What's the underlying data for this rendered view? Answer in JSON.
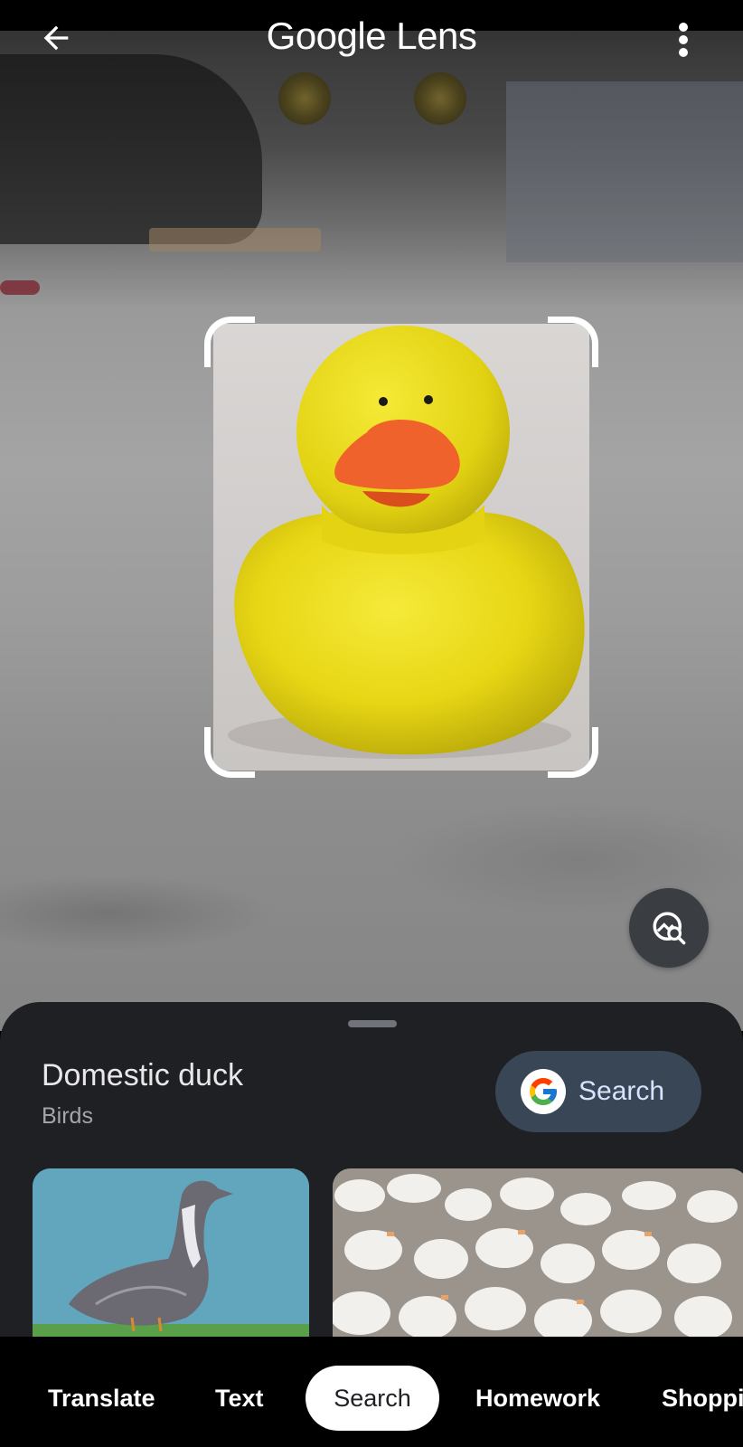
{
  "app": {
    "title": "Google Lens"
  },
  "icons": {
    "back": "arrow-left-icon",
    "more": "more-vert-icon",
    "lens_fab": "image-search-icon",
    "google": "google-g-icon"
  },
  "result": {
    "title": "Domestic duck",
    "subtitle": "Birds",
    "search_button_label": "Search"
  },
  "tabs": [
    {
      "label": "Translate",
      "active": false
    },
    {
      "label": "Text",
      "active": false
    },
    {
      "label": "Search",
      "active": true
    },
    {
      "label": "Homework",
      "active": false
    },
    {
      "label": "Shoppi",
      "active": false
    }
  ],
  "colors": {
    "sheet_bg": "#1f2024",
    "search_pill": "#394656",
    "search_pill_text": "#d7e3ff",
    "duck_yellow": "#f1e117",
    "beak_orange": "#f0622b"
  }
}
